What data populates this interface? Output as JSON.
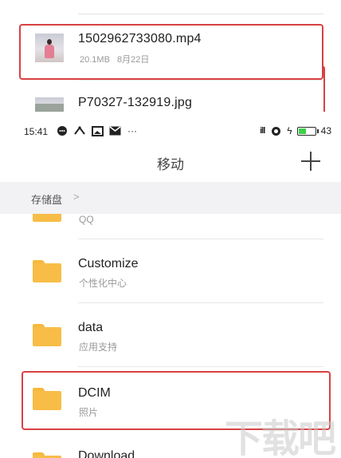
{
  "files": [
    {
      "name": "1502962733080.mp4",
      "size": "20.1MB",
      "date": "8月22日"
    },
    {
      "name": "P70327-132919.jpg"
    }
  ],
  "status_bar": {
    "time": "15:41",
    "battery": "43",
    "left_icons": [
      "chat-bubble-icon",
      "bluetooth-share-icon",
      "image-icon",
      "mail-icon",
      "more-dots-icon"
    ],
    "right_icons": [
      "signal-icon",
      "sync-icon",
      "charging-bolt-icon",
      "battery-icon"
    ],
    "more_dots": "···",
    "bolt": "ϟ",
    "signal_label": "ill",
    "accent_battery": "#3ecf4b"
  },
  "header": {
    "title": "移动",
    "add_icon": "plus-icon"
  },
  "breadcrumb": {
    "label": "存储盘",
    "chevron": ">"
  },
  "folders": [
    {
      "name": "",
      "subtitle": "QQ"
    },
    {
      "name": "Customize",
      "subtitle": "个性化中心"
    },
    {
      "name": "data",
      "subtitle": "应用支持"
    },
    {
      "name": "DCIM",
      "subtitle": "照片"
    },
    {
      "name": "Download",
      "subtitle": ""
    }
  ],
  "highlight_color": "#d84141",
  "folder_color": "#f7bd46",
  "watermark": "下载吧"
}
